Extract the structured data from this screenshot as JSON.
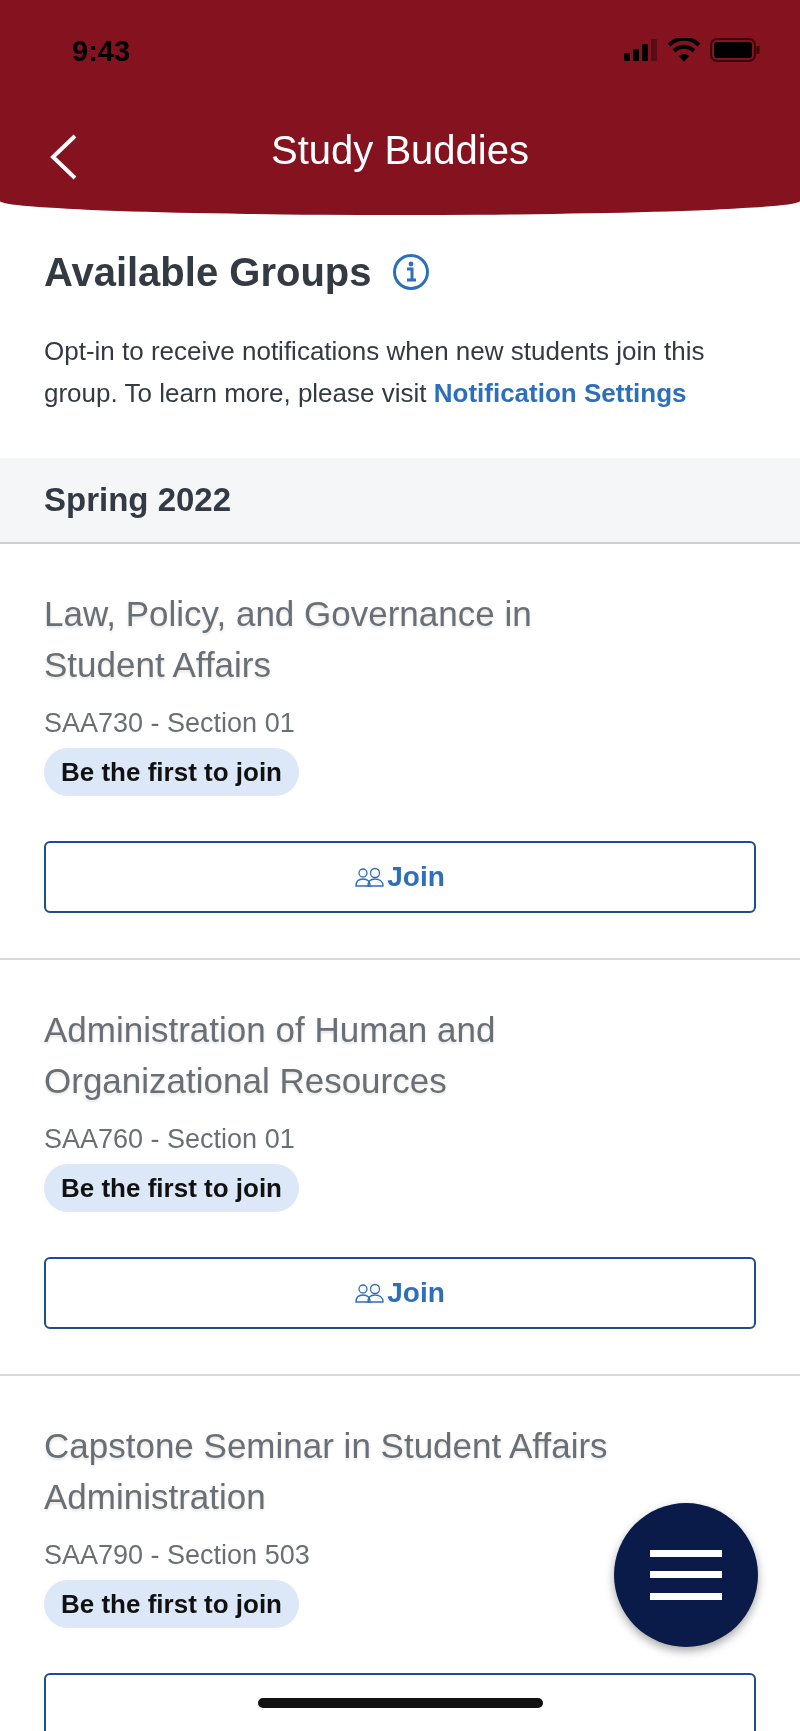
{
  "status_bar": {
    "time": "9:43"
  },
  "header": {
    "title": "Study Buddies"
  },
  "intro": {
    "title": "Available Groups",
    "text": "Opt-in to receive notifications when new students join this group. To learn more, please visit ",
    "link": "Notification Settings"
  },
  "section": {
    "title": "Spring 2022"
  },
  "groups": [
    {
      "title": "Law, Policy, and Governance in Student Affairs",
      "code": "SAA730 - Section 01",
      "badge": "Be the first to join",
      "join_label": "Join"
    },
    {
      "title": "Administration of Human and Organizational Resources",
      "code": "SAA760 - Section 01",
      "badge": "Be the first to join",
      "join_label": "Join"
    },
    {
      "title": "Capstone Seminar in Student Affairs Administration",
      "code": "SAA790 - Section 503",
      "badge": "Be the first to join"
    }
  ]
}
